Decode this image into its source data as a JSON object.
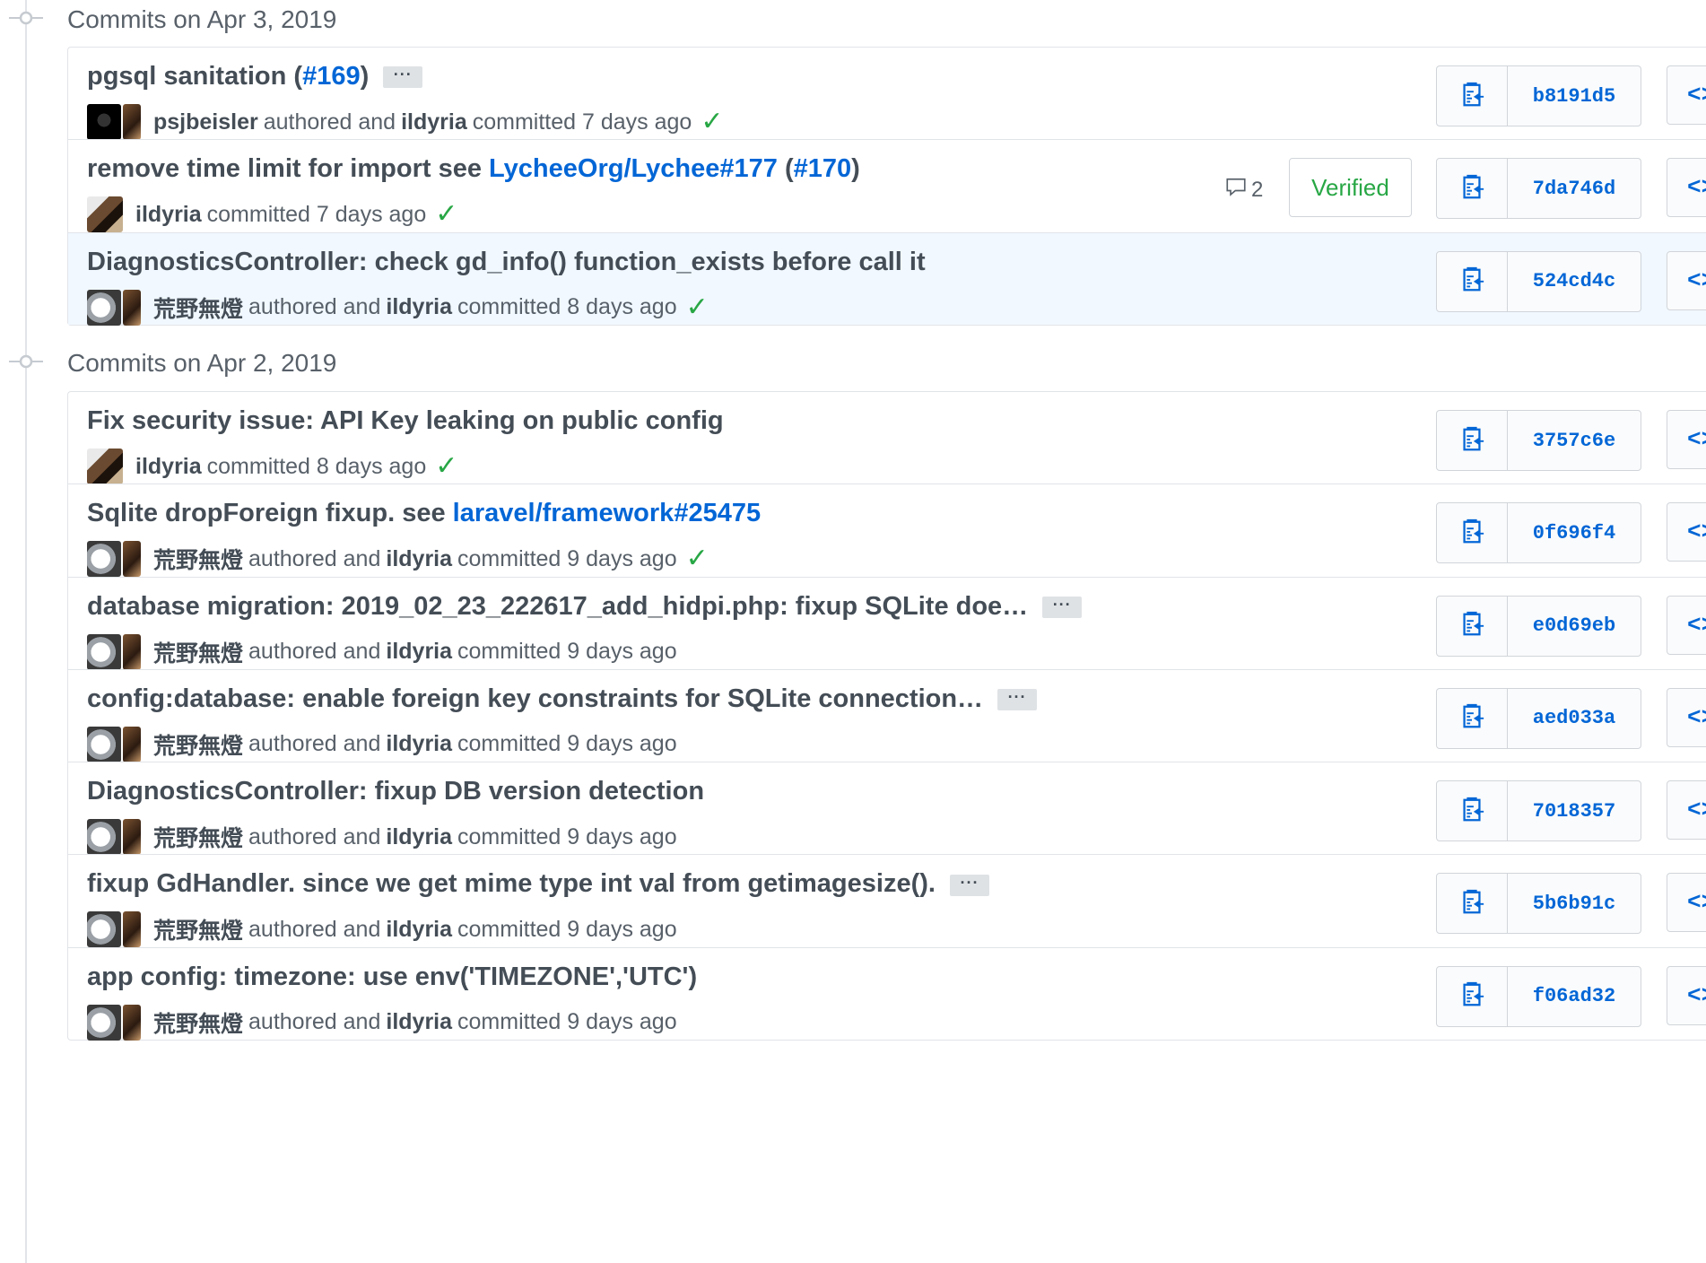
{
  "days": [
    {
      "date_label": "Commits on Apr 3, 2019",
      "commits": [
        {
          "title_parts": [
            {
              "text": "pgsql sanitation (",
              "link": false
            },
            {
              "text": "#169",
              "link": true
            },
            {
              "text": ")",
              "link": false
            }
          ],
          "has_ellipsis": true,
          "avatar": "dark",
          "author": "psjbeisler",
          "authored_text": "authored and",
          "committer": "ildyria",
          "committed_text": "committed 7 days ago",
          "status": "check",
          "sha": "b8191d5",
          "highlight": false
        },
        {
          "title_parts": [
            {
              "text": "remove time limit for import see ",
              "link": false
            },
            {
              "text": "LycheeOrg/Lychee#177",
              "link": true
            },
            {
              "text": " (",
              "link": false
            },
            {
              "text": "#170",
              "link": true
            },
            {
              "text": ")",
              "link": false
            }
          ],
          "has_ellipsis": false,
          "avatar": "ildyria",
          "author": "",
          "authored_text": "",
          "committer": "ildyria",
          "committed_text": "committed 7 days ago",
          "status": "check",
          "comments": "2",
          "verified": "Verified",
          "sha": "7da746d",
          "highlight": false
        },
        {
          "title_parts": [
            {
              "text": "DiagnosticsController: check gd_info() function_exists before call it",
              "link": false
            }
          ],
          "has_ellipsis": false,
          "avatar": "dog",
          "author": "荒野無燈",
          "authored_text": "authored and",
          "committer": "ildyria",
          "committed_text": "committed 8 days ago",
          "status": "check",
          "sha": "524cd4c",
          "highlight": true
        }
      ]
    },
    {
      "date_label": "Commits on Apr 2, 2019",
      "commits": [
        {
          "title_parts": [
            {
              "text": "Fix security issue: API Key leaking on public config",
              "link": false
            }
          ],
          "has_ellipsis": false,
          "avatar": "ildyria",
          "author": "",
          "authored_text": "",
          "committer": "ildyria",
          "committed_text": "committed 8 days ago",
          "status": "check",
          "sha": "3757c6e",
          "highlight": false
        },
        {
          "title_parts": [
            {
              "text": "Sqlite dropForeign fixup. see ",
              "link": false
            },
            {
              "text": "laravel/framework#25475",
              "link": true
            }
          ],
          "has_ellipsis": false,
          "avatar": "dog",
          "author": "荒野無燈",
          "authored_text": "authored and",
          "committer": "ildyria",
          "committed_text": "committed 9 days ago",
          "status": "check",
          "sha": "0f696f4",
          "highlight": false
        },
        {
          "title_parts": [
            {
              "text": "database migration: 2019_02_23_222617_add_hidpi.php: fixup SQLite doe…",
              "link": false
            }
          ],
          "has_ellipsis": true,
          "avatar": "dog",
          "author": "荒野無燈",
          "authored_text": "authored and",
          "committer": "ildyria",
          "committed_text": "committed 9 days ago",
          "status": "",
          "sha": "e0d69eb",
          "highlight": false
        },
        {
          "title_parts": [
            {
              "text": "config:database: enable foreign key constraints for SQLite connection…",
              "link": false
            }
          ],
          "has_ellipsis": true,
          "avatar": "dog",
          "author": "荒野無燈",
          "authored_text": "authored and",
          "committer": "ildyria",
          "committed_text": "committed 9 days ago",
          "status": "",
          "sha": "aed033a",
          "highlight": false
        },
        {
          "title_parts": [
            {
              "text": "DiagnosticsController: fixup DB version detection",
              "link": false
            }
          ],
          "has_ellipsis": false,
          "avatar": "dog",
          "author": "荒野無燈",
          "authored_text": "authored and",
          "committer": "ildyria",
          "committed_text": "committed 9 days ago",
          "status": "",
          "sha": "7018357",
          "highlight": false
        },
        {
          "title_parts": [
            {
              "text": "fixup GdHandler. since we get mime type int val from getimagesize().",
              "link": false
            }
          ],
          "has_ellipsis": true,
          "avatar": "dog",
          "author": "荒野無燈",
          "authored_text": "authored and",
          "committer": "ildyria",
          "committed_text": "committed 9 days ago",
          "status": "",
          "sha": "5b6b91c",
          "highlight": false
        },
        {
          "title_parts": [
            {
              "text": "app config: timezone: use env('TIMEZONE','UTC')",
              "link": false
            }
          ],
          "has_ellipsis": false,
          "avatar": "dog",
          "author": "荒野無燈",
          "authored_text": "authored and",
          "committer": "ildyria",
          "committed_text": "committed 9 days ago",
          "status": "",
          "sha": "f06ad32",
          "highlight": false
        }
      ]
    }
  ],
  "icons": {
    "clipboard": "clipboard-icon",
    "comment": "comment-icon",
    "check": "check-icon",
    "browse": "code-icon"
  },
  "glyphs": {
    "ellipsis": "···",
    "check": "✓",
    "browse": "<>"
  },
  "colors": {
    "link": "#0366d6",
    "success": "#28a745",
    "highlight_bg": "#f1f8ff",
    "border": "#e1e4e8"
  }
}
